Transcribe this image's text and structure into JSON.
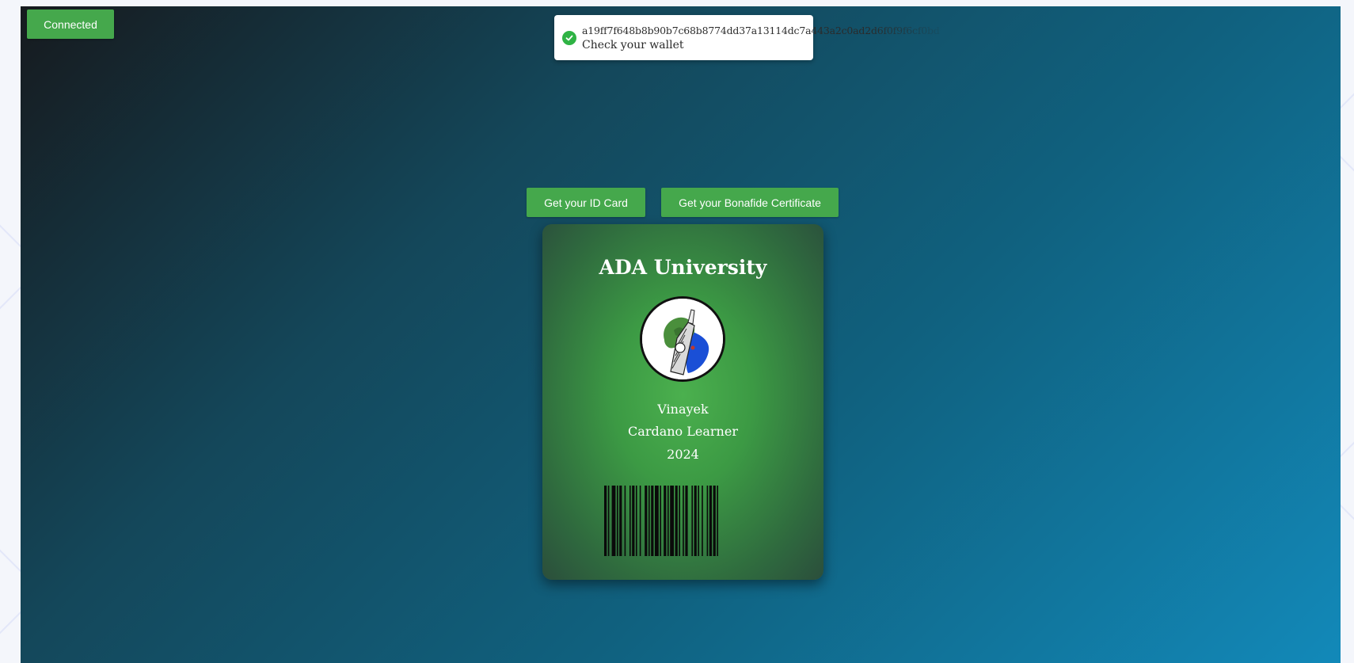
{
  "header": {
    "connect_label": "Connected"
  },
  "toast": {
    "icon": "check-circle-icon",
    "hash": "a19ff7f648b8b90b7c68b8774dd37a13114dc7a443a2c0ad2d6f0f9f6cf0bd",
    "message": "Check your wallet"
  },
  "actions": {
    "id_card_label": "Get your ID Card",
    "certificate_label": "Get your Bonafide Certificate"
  },
  "card": {
    "university": "ADA University",
    "name": "Vinayek",
    "role": "Cardano Learner",
    "year": "2024",
    "avatar": "avatar-illustration"
  },
  "colors": {
    "button_green": "#45a84c",
    "card_green": "#3c9a44",
    "toast_check": "#2fb344"
  }
}
